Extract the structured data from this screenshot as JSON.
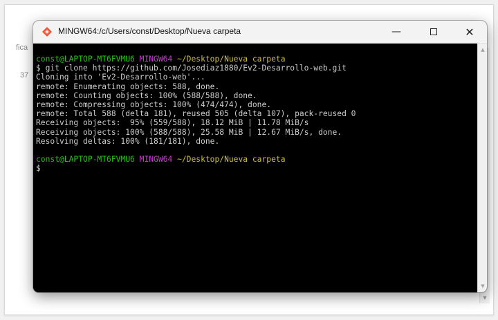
{
  "background": {
    "frag_top": "fica",
    "frag_mid": "37"
  },
  "window": {
    "title": "MINGW64:/c/Users/const/Desktop/Nueva carpeta",
    "app_icon": "git-bash-icon",
    "controls": {
      "minimize_icon": "minimize-icon",
      "maximize_icon": "maximize-icon",
      "close_icon": "close-icon"
    }
  },
  "colors": {
    "prompt_user": "#21c50f",
    "prompt_msystem": "#c83ad3",
    "prompt_path": "#d0c13c",
    "output_text": "#cccccc",
    "terminal_bg": "#000000"
  },
  "terminal": {
    "prompt1": {
      "user": "const@LAPTOP-MT6FVMU6",
      "msystem": "MINGW64",
      "path": "~/Desktop/Nueva carpeta"
    },
    "command": "$ git clone https://github.com/Josediaz1880/Ev2-Desarrollo-web.git",
    "output": [
      "Cloning into 'Ev2-Desarrollo-web'...",
      "remote: Enumerating objects: 588, done.",
      "remote: Counting objects: 100% (588/588), done.",
      "remote: Compressing objects: 100% (474/474), done.",
      "remote: Total 588 (delta 181), reused 505 (delta 107), pack-reused 0",
      "Receiving objects:  95% (559/588), 18.12 MiB | 11.78 MiB/s",
      "Receiving objects: 100% (588/588), 25.58 MiB | 12.67 MiB/s, done.",
      "Resolving deltas: 100% (181/181), done."
    ],
    "prompt2": {
      "user": "const@LAPTOP-MT6FVMU6",
      "msystem": "MINGW64",
      "path": "~/Desktop/Nueva carpeta"
    },
    "cursor_line": "$"
  }
}
